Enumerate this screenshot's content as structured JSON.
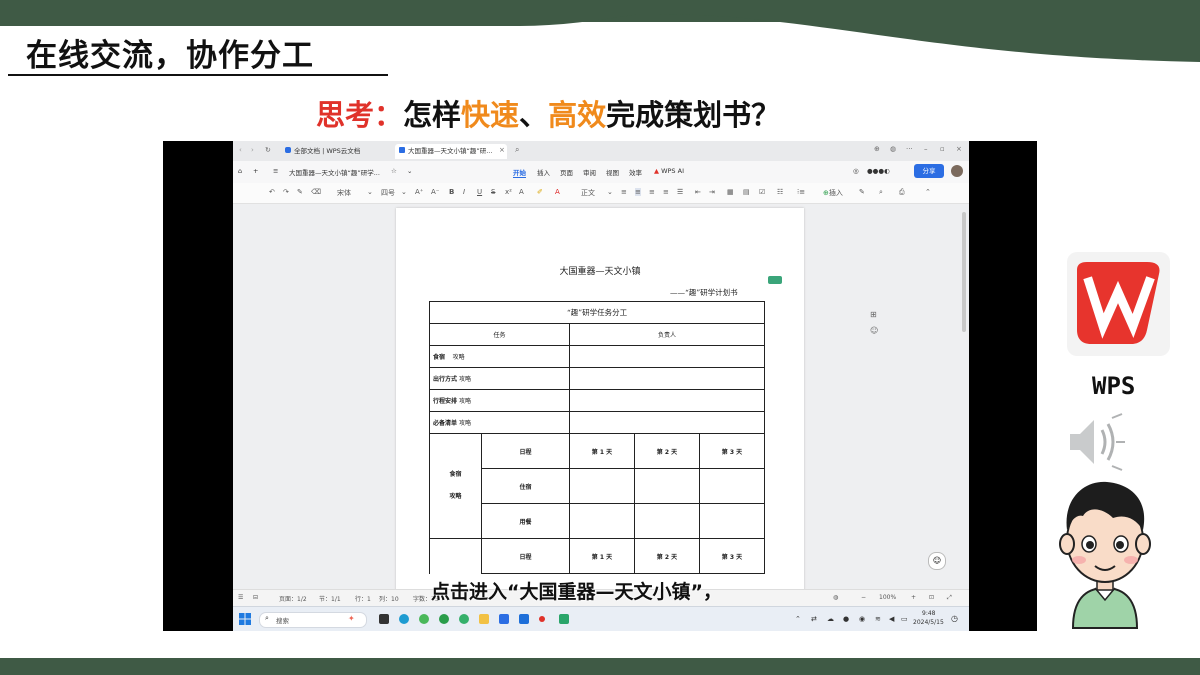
{
  "slide": {
    "title": "在线交流，协作分工",
    "question": {
      "prefix": "思考：",
      "p1": "怎样",
      "h1": "快速",
      "sep": "、",
      "h2": "高效",
      "p2": "完成策划书？"
    },
    "wps_label": "WPS",
    "subtitle": "点击进入“大国重器—天文小镇”，"
  },
  "browser": {
    "tabs": [
      {
        "label": "全部文档 | WPS云文档"
      },
      {
        "label": "大国重器—天文小镇“趣”研..."
      }
    ],
    "new_tab": "+"
  },
  "app": {
    "doc_title": "大国重器—天文小镇“趣”研学...",
    "menu": [
      "开始",
      "插入",
      "页面",
      "审阅",
      "视图",
      "效率",
      "WPS AI"
    ],
    "share": "分享",
    "toolbar": {
      "font": "宋体",
      "size": "四号",
      "style": "正文",
      "insert": "插入"
    }
  },
  "document": {
    "heading": "大国重器—天文小镇",
    "subheading": "——“趣”研学计划书",
    "table_title": "“趣”研学任务分工",
    "col_task": "任务",
    "col_owner": "负责人",
    "rows": [
      {
        "task": "食宿",
        "sub": "攻略"
      },
      {
        "task": "出行方式",
        "sub": "攻略"
      },
      {
        "task": "行程安排",
        "sub": "攻略"
      },
      {
        "task": "必备清单",
        "sub": "攻略"
      }
    ],
    "detail_group_a": "食宿",
    "detail_group_b": "攻略",
    "detail_rows": [
      "日程",
      "住宿",
      "用餐"
    ],
    "days": [
      "第 1 天",
      "第 2 天",
      "第 3 天"
    ],
    "detail_row2": "日程"
  },
  "status": {
    "page": "页面：1/2",
    "section": "节：1/1",
    "line": "行：1",
    "column": "列：10",
    "words": "字数：75",
    "zoom": "100%"
  },
  "taskbar": {
    "search": "搜索",
    "time": "9:48",
    "date": "2024/5/15"
  }
}
